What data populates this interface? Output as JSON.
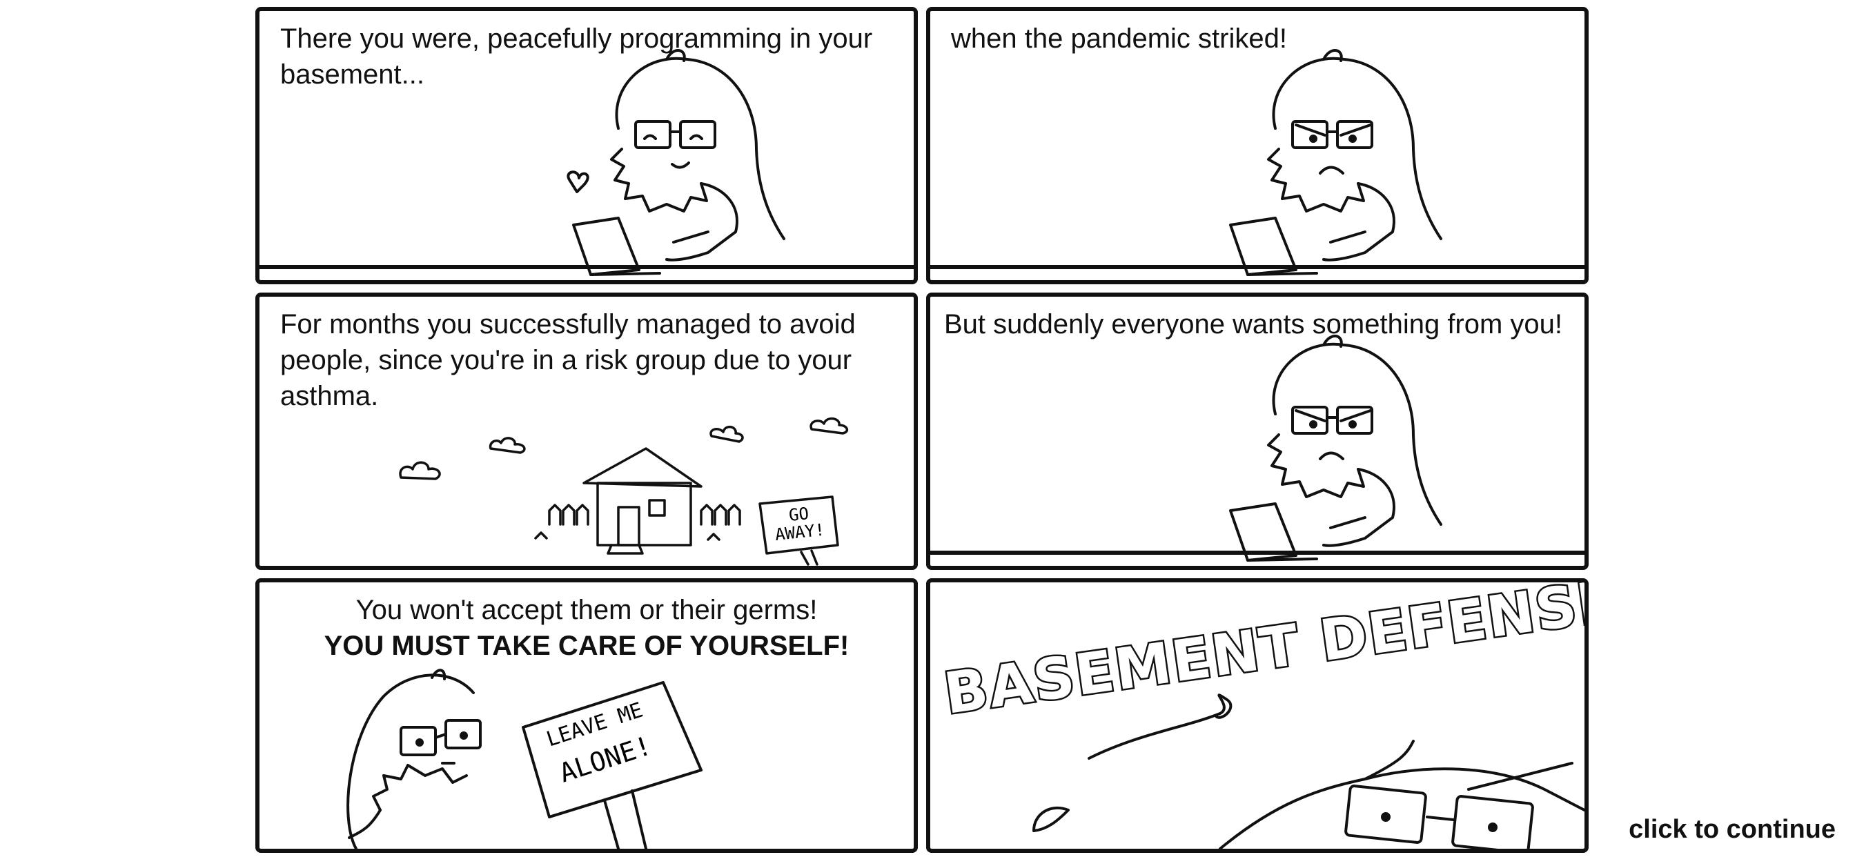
{
  "panels": [
    {
      "caption": "There you were, peacefully programming in your basement..."
    },
    {
      "caption": "when the pandemic striked!"
    },
    {
      "caption": "For months you successfully managed to avoid people, since you're in a risk group due to your asthma.",
      "sign": [
        "GO",
        "AWAY!"
      ]
    },
    {
      "caption": "But suddenly everyone wants something from you!"
    },
    {
      "caption_line1": "You won't accept them or their germs!",
      "caption_line2": "YOU MUST TAKE CARE OF YOURSELF!",
      "sign": [
        "LEAVE ME",
        "ALONE!"
      ]
    },
    {
      "title": "BASEMENT DEFENSE!"
    }
  ],
  "continue_label": "click to continue"
}
